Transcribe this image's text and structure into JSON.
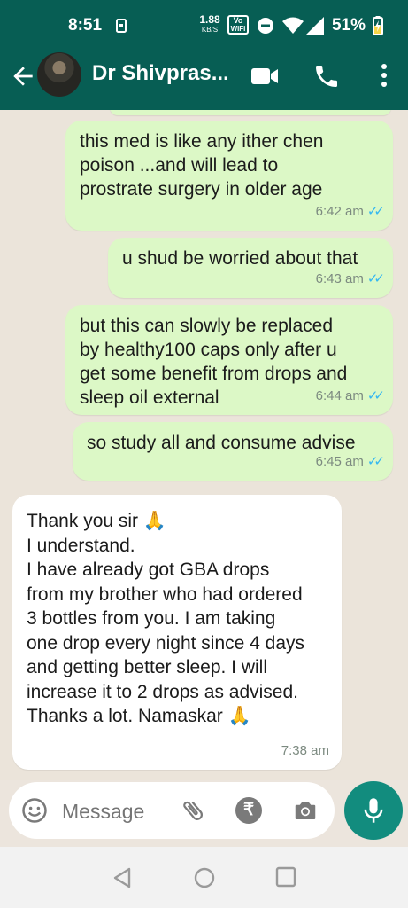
{
  "status_bar": {
    "time": "8:51",
    "net_speed_value": "1.88",
    "net_speed_unit": "KB/S",
    "vowifi_top": "Vo",
    "vowifi_bottom": "WiFi",
    "battery_percent": "51%"
  },
  "header": {
    "contact_name": "Dr Shivpras...",
    "icons": [
      "back-arrow-icon",
      "video-call-icon",
      "phone-icon",
      "more-vert-icon"
    ]
  },
  "messages": [
    {
      "direction": "outgoing",
      "text": "this med is like any ither chen\npoison ...and will lead to\nprostrate surgery in older age",
      "time": "6:42 am",
      "ticks": "✓✓"
    },
    {
      "direction": "outgoing",
      "text": "u shud be worried about that",
      "time": "6:43 am",
      "ticks": "✓✓"
    },
    {
      "direction": "outgoing",
      "text": "but this can slowly be replaced\nby healthy100 caps only after u\nget some benefit from drops and\nsleep oil external",
      "time": "6:44 am",
      "ticks": "✓✓"
    },
    {
      "direction": "outgoing",
      "text": "so study all and consume advise",
      "time": "6:45 am",
      "ticks": "✓✓"
    },
    {
      "direction": "incoming",
      "text": "Thank you sir 🙏\nI understand.\nI have already got GBA drops\nfrom my brother who had ordered\n3 bottles from you. I am taking\none drop every night since 4 days\nand getting better sleep. I will\nincrease it to 2 drops as advised.\nThanks a lot. Namaskar 🙏",
      "time": "7:38 am"
    }
  ],
  "composer": {
    "placeholder": "Message",
    "icons": [
      "emoji-icon",
      "attach-icon",
      "rupee-payment-icon",
      "camera-icon",
      "mic-icon"
    ]
  },
  "colors": {
    "header": "#075e54",
    "outgoing_bubble": "#dcf8c6",
    "incoming_bubble": "#ffffff",
    "tick_blue": "#34b7f1",
    "mic_button": "#128c7e"
  }
}
